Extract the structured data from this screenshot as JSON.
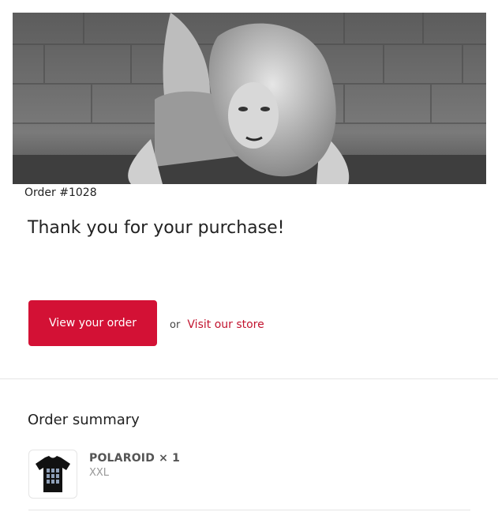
{
  "header": {
    "hero_image": "black-and-white portrait photo"
  },
  "order": {
    "number_label": "Order #1028",
    "thanks_heading": "Thank you for your purchase!"
  },
  "actions": {
    "view_order_label": "View your order",
    "or_label": "or",
    "store_link_label": "Visit our store"
  },
  "summary": {
    "title": "Order summary",
    "items": [
      {
        "title": "POLAROID × 1",
        "variant": "XXL",
        "thumbnail_icon": "tshirt-icon"
      }
    ]
  },
  "colors": {
    "accent": "#d31135",
    "link": "#c2142f",
    "divider": "#e5e5e5"
  }
}
